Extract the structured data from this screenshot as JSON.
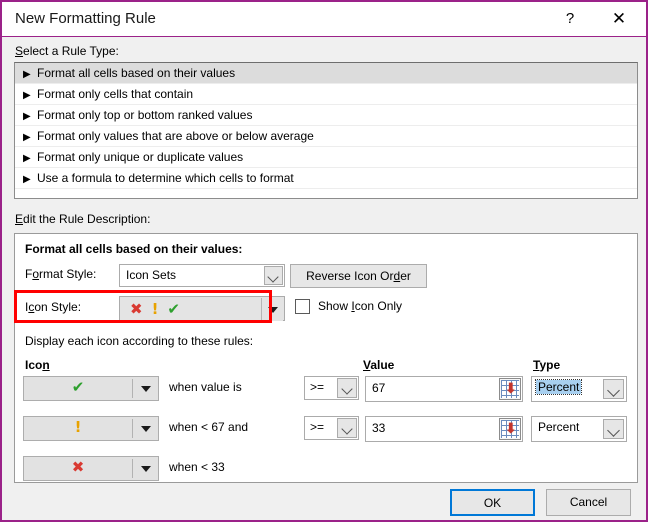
{
  "window": {
    "title": "New Formatting Rule",
    "border_color": "#9B2289",
    "help_icon": "?",
    "close_icon": "✕"
  },
  "rule_type": {
    "label": "Select a Rule Type:",
    "items": [
      {
        "label": "Format all cells based on their values",
        "selected": true
      },
      {
        "label": "Format only cells that contain",
        "selected": false
      },
      {
        "label": "Format only top or bottom ranked values",
        "selected": false
      },
      {
        "label": "Format only values that are above or below average",
        "selected": false
      },
      {
        "label": "Format only unique or duplicate values",
        "selected": false
      },
      {
        "label": "Use a formula to determine which cells to format",
        "selected": false
      }
    ],
    "bullet_icon": "▶"
  },
  "rule_description": {
    "label": "Edit the Rule Description:",
    "heading": "Format all cells based on their values:",
    "format_style_label": "Format Style:",
    "format_style_value": "Icon Sets",
    "reverse_icon_order_label": "Reverse Icon Order",
    "icon_style_label": "Icon Style:",
    "icon_style_icons": [
      "cross-red-icon",
      "exclamation-yellow-icon",
      "check-green-icon"
    ],
    "show_icon_only_label": "Show Icon Only",
    "show_icon_only_checked": false,
    "display_rules_label": "Display each icon according to these rules:",
    "columns": {
      "icon": "Icon",
      "value": "Value",
      "type": "Type"
    },
    "highlight_color": "#FF0000",
    "rows": [
      {
        "icon": "check-green-icon",
        "icon_glyph": "✔",
        "icon_color": "#2EA02E",
        "condition": "when value is",
        "operator": ">=",
        "value": "67",
        "type": "Percent",
        "type_focused": true,
        "has_value_field": true
      },
      {
        "icon": "exclamation-yellow-icon",
        "icon_glyph": "!",
        "icon_color": "#E8A200",
        "condition": "when < 67 and",
        "operator": ">=",
        "value": "33",
        "type": "Percent",
        "type_focused": false,
        "has_value_field": true
      },
      {
        "icon": "cross-red-icon",
        "icon_glyph": "✖",
        "icon_color": "#D93A32",
        "condition": "when < 33",
        "operator": "",
        "value": "",
        "type": "",
        "type_focused": false,
        "has_value_field": false
      }
    ],
    "range_picker_arrow": "⬇"
  },
  "footer": {
    "ok_label": "OK",
    "cancel_label": "Cancel",
    "ok_focus_color": "#0078D7"
  }
}
